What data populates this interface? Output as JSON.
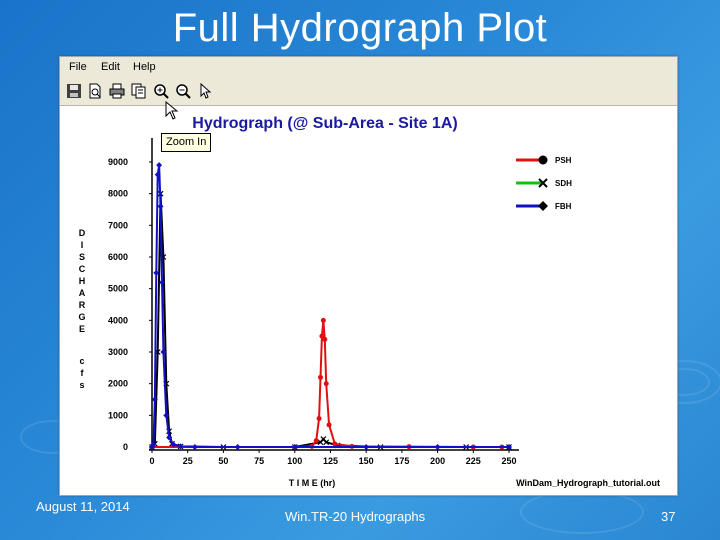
{
  "slide": {
    "title": "Full Hydrograph Plot",
    "date": "August 11, 2014",
    "footer": "Win.TR-20 Hydrographs",
    "page_number": "37"
  },
  "window": {
    "menu": [
      {
        "label": "File"
      },
      {
        "label": "Edit"
      },
      {
        "label": "Help"
      }
    ],
    "toolbar": [
      {
        "icon": "save-icon"
      },
      {
        "icon": "print-preview-icon"
      },
      {
        "icon": "print-icon"
      },
      {
        "icon": "copy-icon"
      },
      {
        "icon": "zoom-in-icon"
      },
      {
        "icon": "zoom-out-icon"
      },
      {
        "icon": "pointer-icon"
      }
    ],
    "tooltip": "Zoom In",
    "filename": "WinDam_Hydrograph_tutorial.out"
  },
  "chart_data": {
    "type": "line",
    "title": "Hydrograph (@ Sub-Area - Site 1A)",
    "xlabel": "T I M E (hr)",
    "ylabel": "D I S C H A R G E  c f s",
    "ylabel_letters": [
      "D",
      "I",
      "S",
      "C",
      "H",
      "A",
      "R",
      "G",
      "E"
    ],
    "ylabel_unit_letters": [
      "c",
      "f",
      "s"
    ],
    "xlim": [
      0,
      250
    ],
    "ylim": [
      0,
      9000
    ],
    "xticks": [
      0,
      25,
      50,
      75,
      100,
      125,
      150,
      175,
      200,
      225,
      250
    ],
    "yticks": [
      0,
      1000,
      2000,
      3000,
      4000,
      5000,
      6000,
      7000,
      8000,
      9000
    ],
    "grid": false,
    "legend_position": "right",
    "series": [
      {
        "name": "PSH",
        "color": "#e01010",
        "marker": "circle",
        "x": [
          0,
          100,
          112,
          115,
          117,
          118,
          119,
          120,
          121,
          122,
          124,
          128,
          140,
          180,
          225,
          245
        ],
        "y": [
          0,
          0,
          20,
          200,
          900,
          2200,
          3500,
          4000,
          3400,
          2000,
          700,
          100,
          20,
          10,
          0,
          0
        ]
      },
      {
        "name": "SDH",
        "color": "#10c010",
        "marker": "x",
        "x": [
          0,
          2,
          4,
          6,
          8,
          10,
          12,
          14,
          20,
          50,
          100,
          118,
          120,
          122,
          130,
          160,
          220,
          250
        ],
        "y": [
          0,
          100,
          3000,
          8000,
          6000,
          2000,
          500,
          100,
          20,
          0,
          0,
          150,
          250,
          150,
          50,
          0,
          0,
          0
        ]
      },
      {
        "name": "FBH",
        "color": "#1010c8",
        "marker": "diamond",
        "x": [
          0,
          1,
          2,
          3,
          4,
          5,
          6,
          7,
          8,
          10,
          12,
          15,
          20,
          30,
          60,
          100,
          150,
          200,
          250
        ],
        "y": [
          0,
          80,
          1500,
          5500,
          8600,
          8900,
          7600,
          5200,
          3000,
          1000,
          300,
          80,
          20,
          0,
          0,
          0,
          0,
          0,
          0
        ]
      }
    ]
  }
}
